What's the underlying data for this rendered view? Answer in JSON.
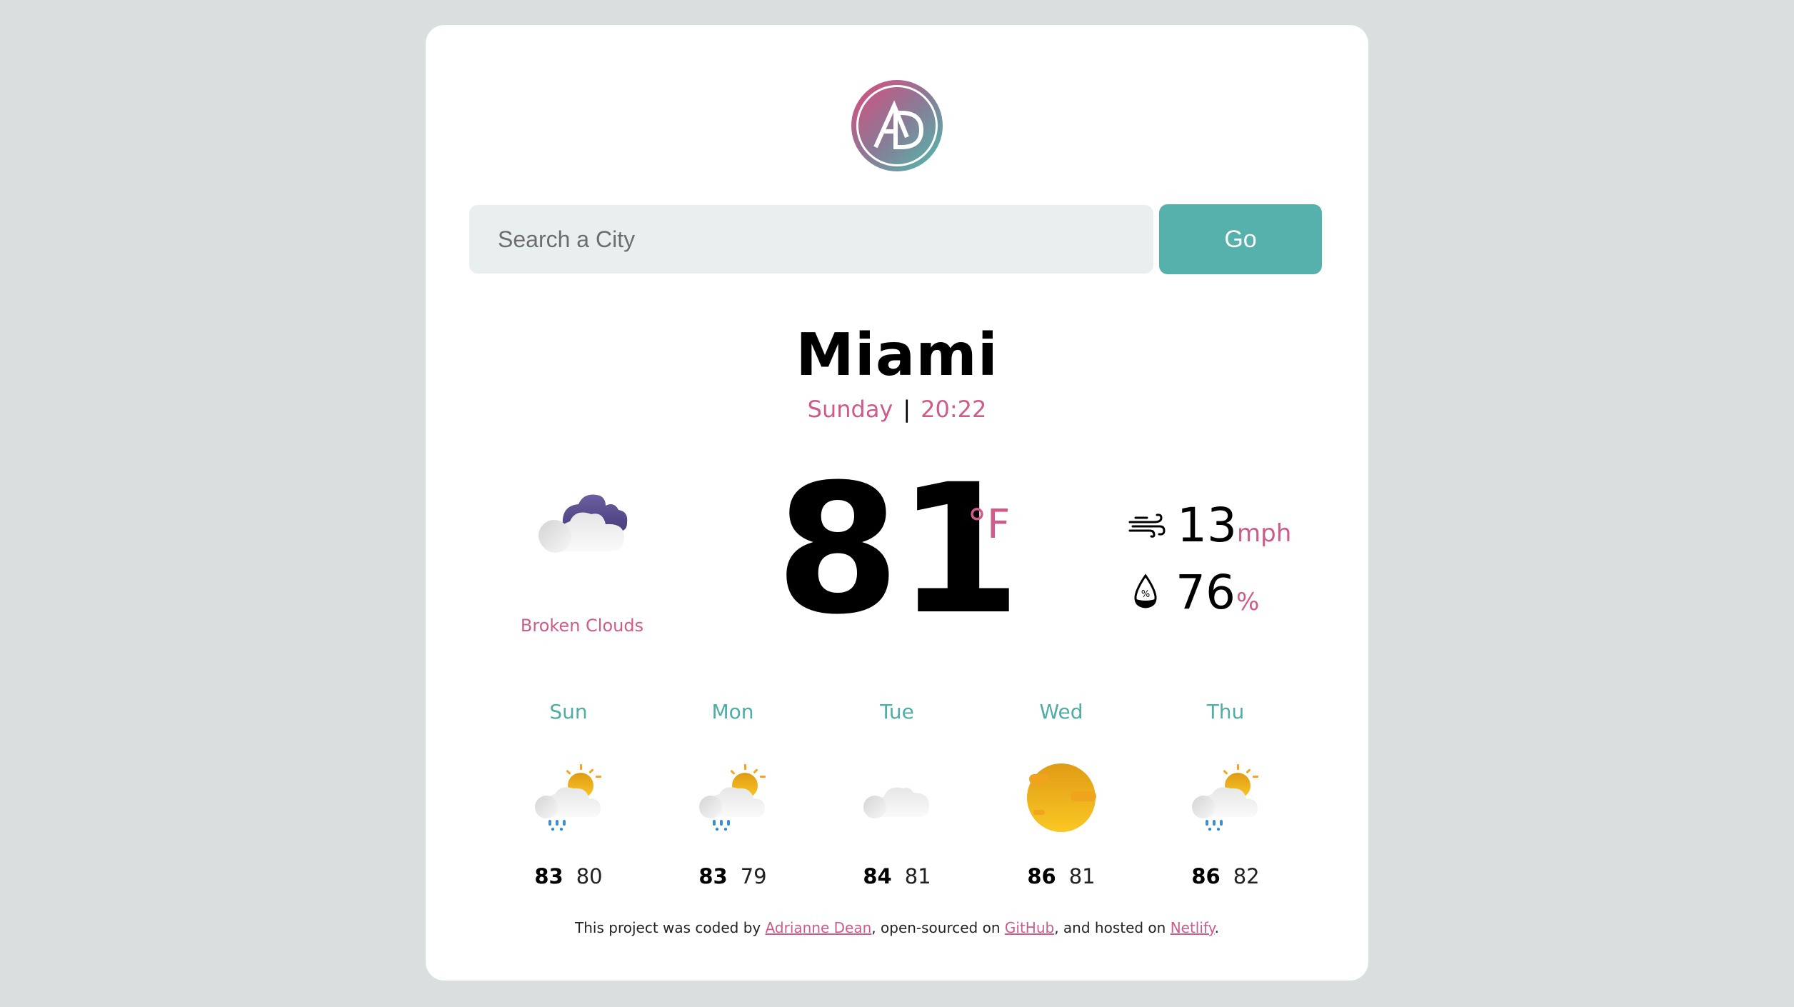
{
  "logo": {
    "initials": "AD"
  },
  "search": {
    "placeholder": "Search a City",
    "value": "",
    "button_label": "Go"
  },
  "current": {
    "city": "Miami",
    "day": "Sunday",
    "separator": "|",
    "time": "20:22",
    "condition": "Broken Clouds",
    "condition_icon": "broken-clouds",
    "temperature": "81",
    "unit": "°F",
    "wind_speed": "13",
    "wind_unit": "mph",
    "humidity": "76",
    "humidity_unit": "%"
  },
  "forecast": [
    {
      "day": "Sun",
      "icon": "rain-sun-cloud",
      "high": "83",
      "low": "80"
    },
    {
      "day": "Mon",
      "icon": "rain-sun-cloud",
      "high": "83",
      "low": "79"
    },
    {
      "day": "Tue",
      "icon": "cloud",
      "high": "84",
      "low": "81"
    },
    {
      "day": "Wed",
      "icon": "sun",
      "high": "86",
      "low": "81"
    },
    {
      "day": "Thu",
      "icon": "rain-sun-cloud",
      "high": "86",
      "low": "82"
    }
  ],
  "footer": {
    "prefix": "This project was coded by ",
    "author_link": "Adrianne Dean",
    "middle": ", open-sourced on ",
    "github_link": "GitHub",
    "middle2": ", and hosted on ",
    "netlify_link": "Netlify",
    "suffix": "."
  },
  "colors": {
    "accent_pink": "#cf5b8a",
    "accent_teal": "#56b0ab",
    "background": "#d9dfdf",
    "input_bg": "#e9efee"
  }
}
